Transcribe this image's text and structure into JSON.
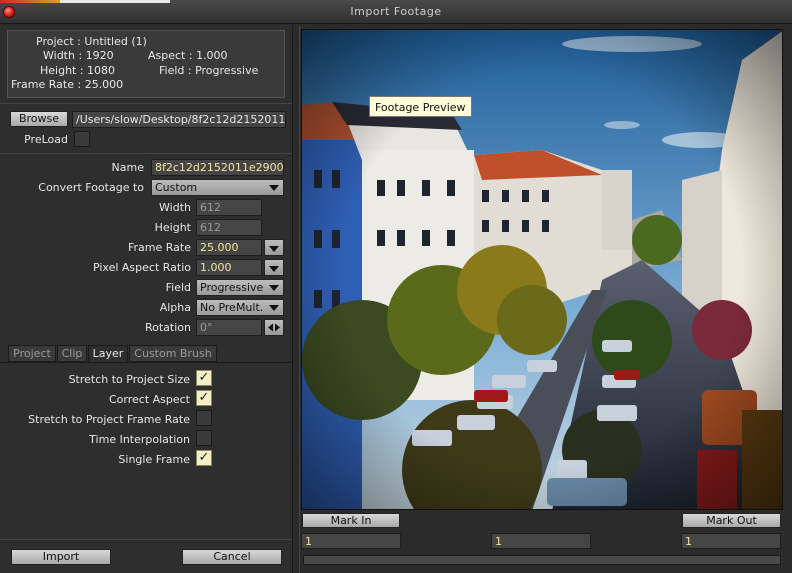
{
  "window": {
    "title": "Import Footage"
  },
  "project_info": {
    "project": "Project : Untitled (1)",
    "width": "Width : 1920",
    "aspect": "Aspect : 1.000",
    "height": "Height : 1080",
    "field": "Field : Progressive",
    "frame_rate": "Frame Rate : 25.000"
  },
  "file": {
    "browse_label": "Browse",
    "path": "/Users/slow/Desktop/8f2c12d2152011",
    "preload_label": "PreLoad"
  },
  "settings": {
    "name_label": "Name",
    "name_value": "8f2c12d2152011e2900",
    "convert_label": "Convert Footage to",
    "convert_value": "Custom",
    "width_label": "Width",
    "width_value": "612",
    "height_label": "Height",
    "height_value": "612",
    "frame_rate_label": "Frame Rate",
    "frame_rate_value": "25.000",
    "pixel_aspect_label": "Pixel Aspect Ratio",
    "pixel_aspect_value": "1.000",
    "field_label": "Field",
    "field_value": "Progressive",
    "alpha_label": "Alpha",
    "alpha_value": "No PreMult.",
    "rotation_label": "Rotation",
    "rotation_value": "0°"
  },
  "tabs": [
    {
      "label": "Project",
      "active": false
    },
    {
      "label": "Clip",
      "active": false
    },
    {
      "label": "Layer",
      "active": true
    },
    {
      "label": "Custom Brush",
      "active": false
    }
  ],
  "options": [
    {
      "label": "Stretch to Project Size",
      "checked": true
    },
    {
      "label": "Correct Aspect",
      "checked": true
    },
    {
      "label": "Stretch to Project Frame Rate",
      "checked": false
    },
    {
      "label": "Time Interpolation",
      "checked": false
    },
    {
      "label": "Single Frame",
      "checked": true
    }
  ],
  "check_glyph": "✓",
  "buttons": {
    "import": "Import",
    "cancel": "Cancel",
    "mark_in": "Mark In",
    "mark_out": "Mark Out"
  },
  "timeline": {
    "in_value": "1",
    "current_value": "1",
    "out_value": "1"
  },
  "preview": {
    "tooltip": "Footage Preview"
  },
  "colors": {
    "check_bg": "#f3efc6",
    "accent_yellow": "#f0e8a0"
  }
}
